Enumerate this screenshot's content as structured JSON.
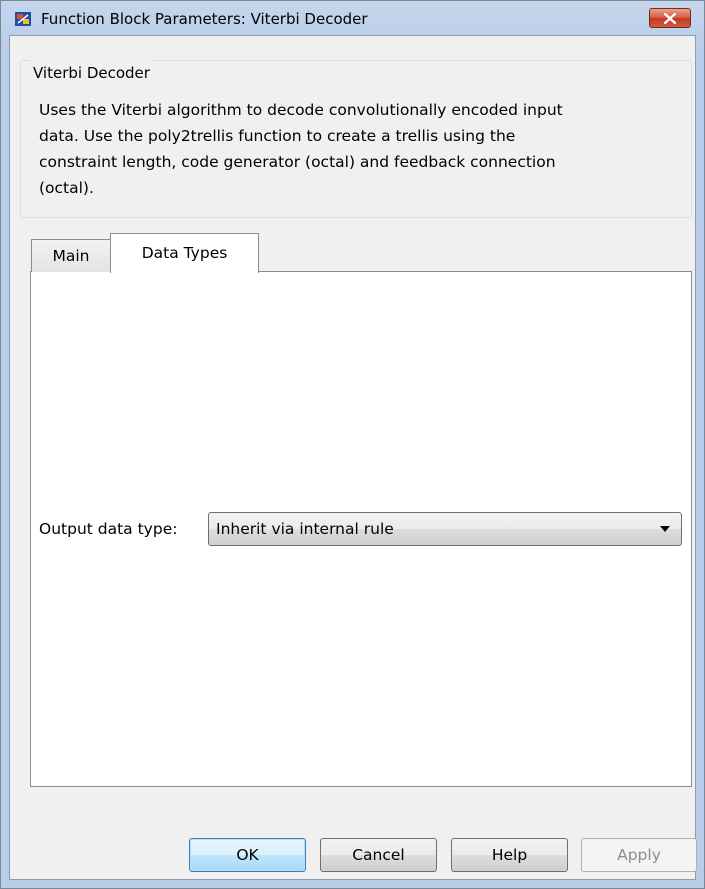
{
  "window": {
    "title": "Function Block Parameters: Viterbi Decoder"
  },
  "block": {
    "group_title": "Viterbi Decoder",
    "description_lines": [
      "Uses the Viterbi algorithm to decode convolutionally encoded input",
      "data.  Use the poly2trellis function to create a trellis using the",
      "constraint length, code generator (octal) and feedback connection",
      "(octal)."
    ]
  },
  "tabs": [
    {
      "label": "Main",
      "active": false
    },
    {
      "label": "Data Types",
      "active": true
    }
  ],
  "data_types": {
    "output_label": "Output data type:",
    "output_value": "Inherit via internal rule"
  },
  "buttons": {
    "ok": "OK",
    "cancel": "Cancel",
    "help": "Help",
    "apply": "Apply"
  },
  "colors": {
    "title_bar": "#bcd0ea",
    "close_button": "#c9432a",
    "ok_button_border": "#3c7fb1"
  },
  "icons": {
    "app": "simulink-block-icon",
    "close": "close-icon",
    "dropdown": "chevron-down-icon"
  }
}
